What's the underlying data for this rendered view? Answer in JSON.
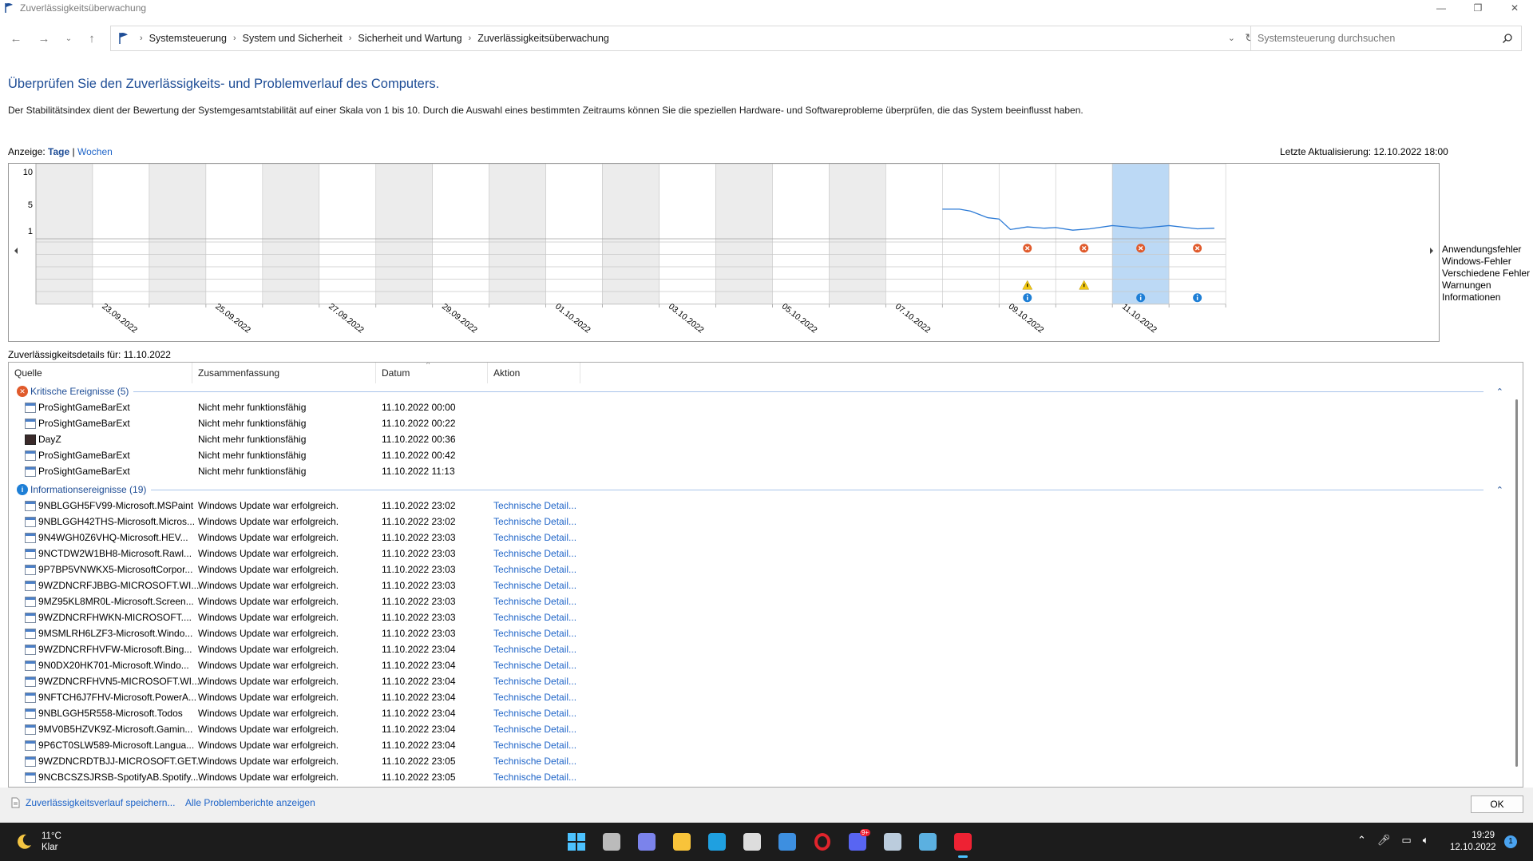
{
  "window": {
    "title": "Zuverlässigkeitsüberwachung",
    "minimize": "—",
    "maximize": "❐",
    "close": "✕"
  },
  "breadcrumb": [
    "Systemsteuerung",
    "System und Sicherheit",
    "Sicherheit und Wartung",
    "Zuverlässigkeitsüberwachung"
  ],
  "search": {
    "placeholder": "Systemsteuerung durchsuchen"
  },
  "header": {
    "title": "Überprüfen Sie den Zuverlässigkeits- und Problemverlauf des Computers.",
    "description": "Der Stabilitätsindex dient der Bewertung der Systemgesamtstabilität auf einer Skala von 1 bis 10. Durch die Auswahl eines bestimmten Zeitraums können Sie die speziellen Hardware- und Softwareprobleme überprüfen, die das System beeinflusst haben."
  },
  "view": {
    "label": "Anzeige:",
    "days": "Tage",
    "separator": "|",
    "weeks": "Wochen",
    "last_update": "Letzte Aktualisierung: 12.10.2022 18:00"
  },
  "chart_data": {
    "type": "line",
    "y_ticks": [
      "10",
      "5",
      "1"
    ],
    "ylim": [
      1,
      10
    ],
    "columns": [
      "22.09.2022",
      "23.09.2022",
      "24.09.2022",
      "25.09.2022",
      "26.09.2022",
      "27.09.2022",
      "28.09.2022",
      "29.09.2022",
      "30.09.2022",
      "01.10.2022",
      "02.10.2022",
      "03.10.2022",
      "04.10.2022",
      "05.10.2022",
      "06.10.2022",
      "07.10.2022",
      "08.10.2022",
      "09.10.2022",
      "10.10.2022",
      "11.10.2022",
      "12.10.2022"
    ],
    "date_labels": [
      "23.09.2022",
      "25.09.2022",
      "27.09.2022",
      "29.09.2022",
      "01.10.2022",
      "03.10.2022",
      "05.10.2022",
      "07.10.2022",
      "09.10.2022",
      "11.10.2022"
    ],
    "selected_column": "11.10.2022",
    "stability_index": [
      {
        "x": 16.0,
        "y": 4.3
      },
      {
        "x": 16.3,
        "y": 4.3
      },
      {
        "x": 16.5,
        "y": 4.0
      },
      {
        "x": 16.8,
        "y": 3.0
      },
      {
        "x": 17.0,
        "y": 2.8
      },
      {
        "x": 17.2,
        "y": 1.2
      },
      {
        "x": 17.5,
        "y": 1.6
      },
      {
        "x": 17.8,
        "y": 1.4
      },
      {
        "x": 18.0,
        "y": 1.5
      },
      {
        "x": 18.3,
        "y": 1.1
      },
      {
        "x": 18.6,
        "y": 1.3
      },
      {
        "x": 19.0,
        "y": 1.8
      },
      {
        "x": 19.5,
        "y": 1.4
      },
      {
        "x": 20.0,
        "y": 1.8
      },
      {
        "x": 20.5,
        "y": 1.3
      },
      {
        "x": 20.8,
        "y": 1.4
      }
    ],
    "legend": [
      "Anwendungsfehler",
      "Windows-Fehler",
      "Verschiedene Fehler",
      "Warnungen",
      "Informationen"
    ],
    "events": [
      {
        "column": "09.10.2022",
        "row": 0,
        "kind": "error"
      },
      {
        "column": "10.10.2022",
        "row": 0,
        "kind": "error"
      },
      {
        "column": "11.10.2022",
        "row": 0,
        "kind": "error"
      },
      {
        "column": "12.10.2022",
        "row": 0,
        "kind": "error"
      },
      {
        "column": "09.10.2022",
        "row": 3,
        "kind": "warning"
      },
      {
        "column": "10.10.2022",
        "row": 3,
        "kind": "warning"
      },
      {
        "column": "09.10.2022",
        "row": 4,
        "kind": "info"
      },
      {
        "column": "11.10.2022",
        "row": 4,
        "kind": "info"
      },
      {
        "column": "12.10.2022",
        "row": 4,
        "kind": "info"
      }
    ],
    "colors": {
      "selected": "#bcd9f5",
      "weekend": "#ececec",
      "line": "#2b7ad6",
      "error": "#e05a2b",
      "warning": "#f2c811",
      "info": "#1e7fd6"
    }
  },
  "details": {
    "label": "Zuverlässigkeitsdetails für: 11.10.2022"
  },
  "table": {
    "columns": [
      "Quelle",
      "Zusammenfassung",
      "Datum",
      "Aktion"
    ],
    "groups": [
      {
        "label": "Kritische Ereignisse (5)",
        "kind": "error",
        "rows": [
          {
            "source": "ProSightGameBarExt",
            "summary": "Nicht mehr funktionsfähig",
            "date": "11.10.2022 00:00",
            "action": ""
          },
          {
            "source": "ProSightGameBarExt",
            "summary": "Nicht mehr funktionsfähig",
            "date": "11.10.2022 00:22",
            "action": ""
          },
          {
            "source": "DayZ",
            "summary": "Nicht mehr funktionsfähig",
            "date": "11.10.2022 00:36",
            "action": ""
          },
          {
            "source": "ProSightGameBarExt",
            "summary": "Nicht mehr funktionsfähig",
            "date": "11.10.2022 00:42",
            "action": ""
          },
          {
            "source": "ProSightGameBarExt",
            "summary": "Nicht mehr funktionsfähig",
            "date": "11.10.2022 11:13",
            "action": ""
          }
        ]
      },
      {
        "label": "Informationsereignisse (19)",
        "kind": "info",
        "rows": [
          {
            "source": "9NBLGGH5FV99-Microsoft.MSPaint",
            "summary": "Windows Update war erfolgreich.",
            "date": "11.10.2022 23:02",
            "action": "Technische Detail..."
          },
          {
            "source": "9NBLGGH42THS-Microsoft.Micros...",
            "summary": "Windows Update war erfolgreich.",
            "date": "11.10.2022 23:02",
            "action": "Technische Detail..."
          },
          {
            "source": "9N4WGH0Z6VHQ-Microsoft.HEV...",
            "summary": "Windows Update war erfolgreich.",
            "date": "11.10.2022 23:03",
            "action": "Technische Detail..."
          },
          {
            "source": "9NCTDW2W1BH8-Microsoft.Rawl...",
            "summary": "Windows Update war erfolgreich.",
            "date": "11.10.2022 23:03",
            "action": "Technische Detail..."
          },
          {
            "source": "9P7BP5VNWKX5-MicrosoftCorpor...",
            "summary": "Windows Update war erfolgreich.",
            "date": "11.10.2022 23:03",
            "action": "Technische Detail..."
          },
          {
            "source": "9WZDNCRFJBBG-MICROSOFT.WI...",
            "summary": "Windows Update war erfolgreich.",
            "date": "11.10.2022 23:03",
            "action": "Technische Detail..."
          },
          {
            "source": "9MZ95KL8MR0L-Microsoft.Screen...",
            "summary": "Windows Update war erfolgreich.",
            "date": "11.10.2022 23:03",
            "action": "Technische Detail..."
          },
          {
            "source": "9WZDNCRFHWKN-MICROSOFT....",
            "summary": "Windows Update war erfolgreich.",
            "date": "11.10.2022 23:03",
            "action": "Technische Detail..."
          },
          {
            "source": "9MSMLRH6LZF3-Microsoft.Windo...",
            "summary": "Windows Update war erfolgreich.",
            "date": "11.10.2022 23:03",
            "action": "Technische Detail..."
          },
          {
            "source": "9WZDNCRFHVFW-Microsoft.Bing...",
            "summary": "Windows Update war erfolgreich.",
            "date": "11.10.2022 23:04",
            "action": "Technische Detail..."
          },
          {
            "source": "9N0DX20HK701-Microsoft.Windo...",
            "summary": "Windows Update war erfolgreich.",
            "date": "11.10.2022 23:04",
            "action": "Technische Detail..."
          },
          {
            "source": "9WZDNCRFHVN5-MICROSOFT.WI...",
            "summary": "Windows Update war erfolgreich.",
            "date": "11.10.2022 23:04",
            "action": "Technische Detail..."
          },
          {
            "source": "9NFTCH6J7FHV-Microsoft.PowerA...",
            "summary": "Windows Update war erfolgreich.",
            "date": "11.10.2022 23:04",
            "action": "Technische Detail..."
          },
          {
            "source": "9NBLGGH5R558-Microsoft.Todos",
            "summary": "Windows Update war erfolgreich.",
            "date": "11.10.2022 23:04",
            "action": "Technische Detail..."
          },
          {
            "source": "9MV0B5HZVK9Z-Microsoft.Gamin...",
            "summary": "Windows Update war erfolgreich.",
            "date": "11.10.2022 23:04",
            "action": "Technische Detail..."
          },
          {
            "source": "9P6CT0SLW589-Microsoft.Langua...",
            "summary": "Windows Update war erfolgreich.",
            "date": "11.10.2022 23:04",
            "action": "Technische Detail..."
          },
          {
            "source": "9WZDNCRDTBJJ-MICROSOFT.GET...",
            "summary": "Windows Update war erfolgreich.",
            "date": "11.10.2022 23:05",
            "action": "Technische Detail..."
          },
          {
            "source": "9NCBCSZSJRSB-SpotifyAB.Spotify...",
            "summary": "Windows Update war erfolgreich.",
            "date": "11.10.2022 23:05",
            "action": "Technische Detail..."
          }
        ]
      }
    ]
  },
  "footer": {
    "save_link": "Zuverlässigkeitsverlauf speichern...",
    "reports_link": "Alle Problemberichte anzeigen",
    "ok": "OK"
  },
  "taskbar": {
    "temperature": "11°C",
    "weather": "Klar",
    "time": "19:29",
    "date": "12.10.2022",
    "discord_badge": "9+",
    "notification_count": "1",
    "apps": [
      "windows-start-icon",
      "task-view-icon",
      "teams-chat-icon",
      "file-explorer-icon",
      "edge-icon",
      "store-icon",
      "mail-icon",
      "opera-icon",
      "discord-icon",
      "notepad-icon",
      "remote-desktop-icon",
      "reliability-monitor-icon"
    ]
  }
}
